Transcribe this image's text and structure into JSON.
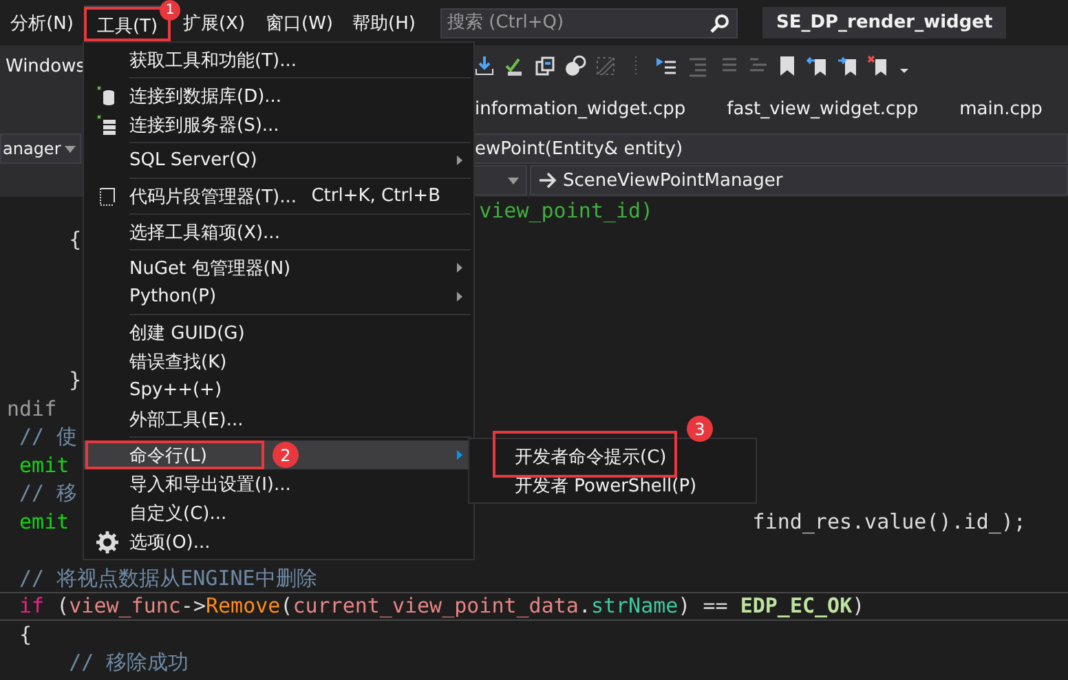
{
  "menubar": [
    {
      "label": "分析(N)",
      "selected": false
    },
    {
      "label": "工具(T)",
      "selected": true
    },
    {
      "label": "扩展(X)",
      "selected": false
    },
    {
      "label": "窗口(W)",
      "selected": false
    },
    {
      "label": "帮助(H)",
      "selected": false
    }
  ],
  "search": {
    "placeholder": "搜索 (Ctrl+Q)"
  },
  "solution_title": "SE_DP_render_widget",
  "toolbar": {
    "label": "Windows"
  },
  "tabs": [
    {
      "label": "information_widget.cpp"
    },
    {
      "label": "fast_view_widget.cpp"
    },
    {
      "label": "main.cpp"
    }
  ],
  "navigation": {
    "type_scope": "anager",
    "member": "ewPoint(Entity& entity)",
    "scope_path": "SceneViewPointManager"
  },
  "code_lines": [
    {
      "kind": "past_menu",
      "tokens": [
        {
          "kind": "param",
          "text": "view_point_id)"
        }
      ]
    },
    {
      "kind": "block",
      "tokens": [
        {
          "kind": "plain",
          "text": "{"
        }
      ]
    },
    {
      "kind": "blank"
    },
    {
      "kind": "blank"
    },
    {
      "kind": "blank"
    },
    {
      "kind": "blank"
    },
    {
      "kind": "block",
      "tokens": [
        {
          "kind": "plain",
          "text": "}"
        }
      ]
    },
    {
      "kind": "root",
      "tokens": [
        {
          "kind": "preprocessor",
          "text": "ndif"
        }
      ]
    },
    {
      "kind": "statement",
      "tokens": [
        {
          "kind": "comment",
          "text": "// 使"
        }
      ]
    },
    {
      "kind": "statement",
      "tokens": [
        {
          "kind": "emit",
          "text": "emit"
        }
      ]
    },
    {
      "kind": "statement",
      "tokens": [
        {
          "kind": "comment",
          "text": "// 移"
        }
      ]
    },
    {
      "kind": "statement",
      "tokens": [
        {
          "kind": "emit",
          "text": "emit"
        }
      ],
      "tail": [
        {
          "kind": "plain",
          "text": "find_res.value().id_);"
        }
      ]
    },
    {
      "kind": "blank"
    },
    {
      "kind": "statement",
      "tokens": [
        {
          "kind": "comment",
          "text": "// 将视点数据从ENGINE中删除"
        }
      ]
    },
    {
      "kind": "current",
      "tokens": [
        {
          "kind": "keyword",
          "text": "if"
        },
        {
          "kind": "plain",
          "text": " ("
        },
        {
          "kind": "variable",
          "text": "view_func"
        },
        {
          "kind": "plain",
          "text": "->"
        },
        {
          "kind": "function",
          "text": "Remove"
        },
        {
          "kind": "plain",
          "text": "("
        },
        {
          "kind": "variable",
          "text": "current_view_point_data"
        },
        {
          "kind": "plain",
          "text": "."
        },
        {
          "kind": "member",
          "text": "strName"
        },
        {
          "kind": "plain",
          "text": ") == "
        },
        {
          "kind": "macro",
          "text": "EDP_EC_OK"
        },
        {
          "kind": "plain",
          "text": ")"
        }
      ]
    },
    {
      "kind": "statement",
      "tokens": [
        {
          "kind": "plain",
          "text": "{"
        }
      ]
    },
    {
      "kind": "block",
      "tokens": [
        {
          "kind": "comment",
          "text": "// 移除成功"
        }
      ]
    }
  ],
  "tools_menu": [
    {
      "kind": "item",
      "label": "获取工具和功能(T)...",
      "selected": false
    },
    {
      "kind": "separator"
    },
    {
      "kind": "item",
      "label": "连接到数据库(D)...",
      "selected": false
    },
    {
      "kind": "item",
      "label": "连接到服务器(S)...",
      "selected": false
    },
    {
      "kind": "separator"
    },
    {
      "kind": "submenu",
      "label": "SQL Server(Q)",
      "selected": false
    },
    {
      "kind": "separator"
    },
    {
      "kind": "item",
      "label": "代码片段管理器(T)...",
      "shortcut": "Ctrl+K, Ctrl+B",
      "selected": false
    },
    {
      "kind": "separator"
    },
    {
      "kind": "item",
      "label": "选择工具箱项(X)...",
      "selected": false
    },
    {
      "kind": "separator"
    },
    {
      "kind": "submenu",
      "label": "NuGet 包管理器(N)",
      "selected": false
    },
    {
      "kind": "submenu",
      "label": "Python(P)",
      "selected": false
    },
    {
      "kind": "separator"
    },
    {
      "kind": "item",
      "label": "创建 GUID(G)",
      "selected": false
    },
    {
      "kind": "item",
      "label": "错误查找(K)",
      "selected": false
    },
    {
      "kind": "item",
      "label": "Spy++(+)",
      "selected": false
    },
    {
      "kind": "item",
      "label": "外部工具(E)...",
      "selected": false
    },
    {
      "kind": "separator"
    },
    {
      "kind": "submenu",
      "label": "命令行(L)",
      "selected": true
    },
    {
      "kind": "item",
      "label": "导入和导出设置(I)...",
      "selected": false
    },
    {
      "kind": "item",
      "label": "自定义(C)...",
      "selected": false
    },
    {
      "kind": "item",
      "label": "选项(O)...",
      "selected": false
    }
  ],
  "command_line_submenu": [
    {
      "label": "开发者命令提示(C)"
    },
    {
      "label": "开发者 PowerShell(P)"
    }
  ],
  "annotations": [
    {
      "number": "1"
    },
    {
      "number": "2"
    },
    {
      "number": "3"
    }
  ]
}
